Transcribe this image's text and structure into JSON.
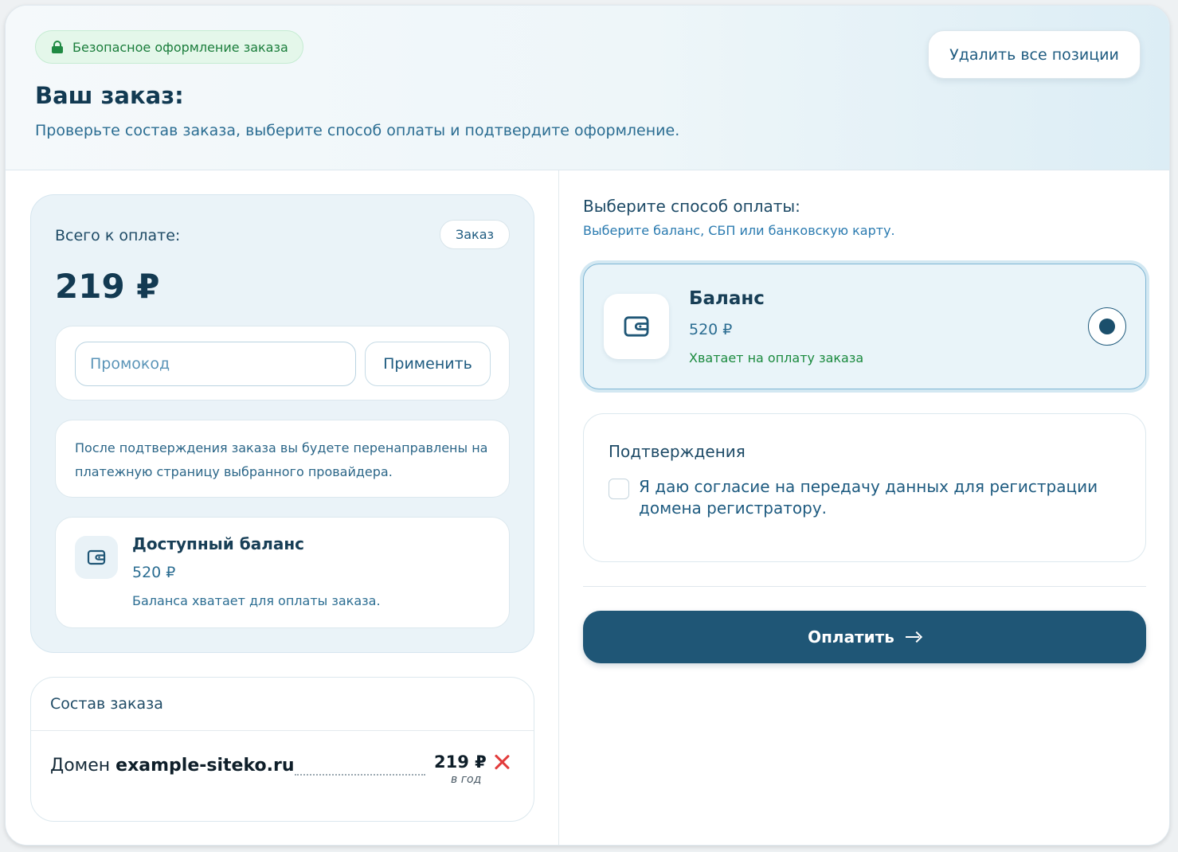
{
  "header": {
    "secure_badge": "Безопасное оформление заказа",
    "title": "Ваш заказ:",
    "subtitle": "Проверьте состав заказа, выберите способ оплаты и подтвердите оформление.",
    "clear_all_label": "Удалить все позиции"
  },
  "summary": {
    "total_label": "Всего к оплате:",
    "order_chip": "Заказ",
    "total_amount": "219 ₽",
    "promo": {
      "placeholder": "Промокод",
      "value": "",
      "apply_label": "Применить"
    },
    "redirect_note": "После подтверждения заказа вы будете перенаправлены на платежную страницу выбранного провайдера.",
    "balance": {
      "title": "Доступный баланс",
      "amount": "520 ₽",
      "note": "Баланса хватает для оплаты заказа.",
      "icon": "wallet-icon"
    }
  },
  "order_items": {
    "title": "Состав заказа",
    "items": [
      {
        "prefix": "Домен ",
        "name": "example-siteko.ru",
        "price": "219 ₽",
        "period": "в год"
      }
    ]
  },
  "payment": {
    "title": "Выберите способ оплаты:",
    "subtitle": "Выберите баланс, СБП или банковскую карту.",
    "methods": [
      {
        "name": "Баланс",
        "amount": "520 ₽",
        "note": "Хватает на оплату заказа",
        "selected": true,
        "icon": "wallet-icon"
      }
    ]
  },
  "confirmations": {
    "title": "Подтверждения",
    "consent_text": "Я даю согласие на передачу данных для регистрации домена регистратору.",
    "checked": false
  },
  "pay_button_label": "Оплатить",
  "colors": {
    "primary": "#1f5676",
    "success": "#1a8a3e",
    "danger": "#e23c3c",
    "accent_text": "#2b6d92"
  }
}
